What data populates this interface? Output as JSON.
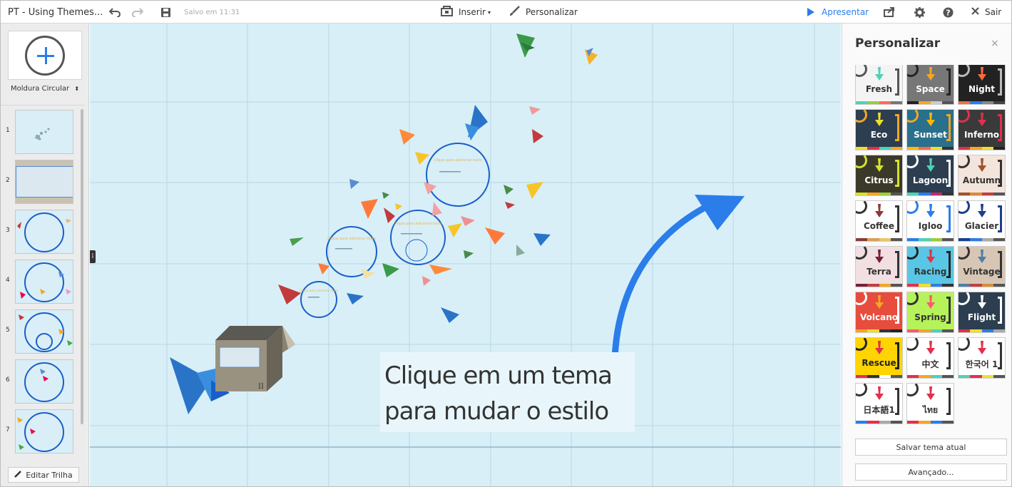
{
  "topbar": {
    "doc_title": "PT - Using Themes...",
    "saved": "Salvo em 11:31",
    "insert": "Inserir",
    "customize": "Personalizar",
    "present": "Apresentar",
    "exit": "Sair"
  },
  "left": {
    "frame_type": "Moldura Circular",
    "thumb_numbers": [
      "1",
      "2",
      "3",
      "4",
      "5",
      "6",
      "7"
    ],
    "edit_trail": "Editar Trilha"
  },
  "canvas": {
    "caption_line1": "Clique em um tema",
    "caption_line2": "para mudar o estilo",
    "frame_text": "Clique para adicionar texto",
    "box_label": "II",
    "side_tab": "⁞"
  },
  "right": {
    "title": "Personalizar",
    "close": "×",
    "save_theme": "Salvar tema atual",
    "advanced": "Avançado...",
    "themes": [
      {
        "name": "Fresh",
        "bg": "#f4f4f4",
        "fg": "#333333",
        "accent": "#4fd1b4",
        "bracket": "#555555",
        "band": [
          "#4fd1b4",
          "#9ccc3a",
          "#ff6a5a",
          "#777"
        ]
      },
      {
        "name": "Space",
        "bg": "#777777",
        "fg": "#ffffff",
        "accent": "#f5a623",
        "bracket": "#222222",
        "band": [
          "#222",
          "#f5a623",
          "#ccc",
          "#555"
        ]
      },
      {
        "name": "Night",
        "bg": "#222222",
        "fg": "#ffffff",
        "accent": "#ff6a3d",
        "bracket": "#bbbbbb",
        "band": [
          "#ff6a3d",
          "#2b7de9",
          "#888",
          "#444"
        ]
      },
      {
        "name": "Eco",
        "bg": "#2c3e50",
        "fg": "#ffffff",
        "accent": "#f1e027",
        "bracket": "#f5a623",
        "band": [
          "#f1e027",
          "#e0314b",
          "#4fd1b4",
          "#f5a623"
        ]
      },
      {
        "name": "Sunset",
        "bg": "#2a6f8c",
        "fg": "#ffffff",
        "accent": "#ffb800",
        "bracket": "#f5a623",
        "band": [
          "#ffb800",
          "#ff6a3d",
          "#f1e027",
          "#333"
        ]
      },
      {
        "name": "Inferno",
        "bg": "#3a3a3a",
        "fg": "#ffffff",
        "accent": "#e0314b",
        "bracket": "#e0314b",
        "band": [
          "#e0314b",
          "#f5a623",
          "#f1e027",
          "#222"
        ]
      },
      {
        "name": "Citrus",
        "bg": "#3b3a2a",
        "fg": "#ffffff",
        "accent": "#d6e32a",
        "bracket": "#d6e32a",
        "band": [
          "#d6e32a",
          "#f5a623",
          "#9ccc3a",
          "#555"
        ]
      },
      {
        "name": "Lagoon",
        "bg": "#2c3e50",
        "fg": "#ffffff",
        "accent": "#4fd1b4",
        "bracket": "#ffffff",
        "band": [
          "#4fd1b4",
          "#2b7de9",
          "#c02a6a",
          "#333"
        ]
      },
      {
        "name": "Autumn",
        "bg": "#f3e4dc",
        "fg": "#333333",
        "accent": "#a0522d",
        "bracket": "#333333",
        "band": [
          "#a0522d",
          "#d98c3a",
          "#c04040",
          "#555"
        ]
      },
      {
        "name": "Coffee",
        "bg": "#ffffff",
        "fg": "#333333",
        "accent": "#8b3a3a",
        "bracket": "#333333",
        "band": [
          "#8b3a3a",
          "#d4a15a",
          "#e9c46a",
          "#555"
        ]
      },
      {
        "name": "Igloo",
        "bg": "#ffffff",
        "fg": "#333333",
        "accent": "#2b7de9",
        "bracket": "#2b7de9",
        "band": [
          "#2b7de9",
          "#4fd1b4",
          "#9ccc3a",
          "#555"
        ]
      },
      {
        "name": "Glacier",
        "bg": "#ffffff",
        "fg": "#333333",
        "accent": "#1a3e8c",
        "bracket": "#1a3e8c",
        "band": [
          "#1a3e8c",
          "#2b7de9",
          "#aaa",
          "#555"
        ]
      },
      {
        "name": "Terra",
        "bg": "#f1dfe1",
        "fg": "#333333",
        "accent": "#7a1e3a",
        "bracket": "#333333",
        "band": [
          "#7a1e3a",
          "#c04040",
          "#f5a623",
          "#555"
        ]
      },
      {
        "name": "Racing",
        "bg": "#59c6e6",
        "fg": "#333333",
        "accent": "#e0314b",
        "bracket": "#222222",
        "band": [
          "#e0314b",
          "#f1e027",
          "#2b7de9",
          "#333"
        ]
      },
      {
        "name": "Vintage",
        "bg": "#d8c6b5",
        "fg": "#333333",
        "accent": "#4d7ea8",
        "bracket": "#333333",
        "band": [
          "#4d7ea8",
          "#c04040",
          "#d98c3a",
          "#555"
        ]
      },
      {
        "name": "Volcano",
        "bg": "#e74c3c",
        "fg": "#ffffff",
        "accent": "#f5a623",
        "bracket": "#ffffff",
        "band": [
          "#f5a623",
          "#f1e027",
          "#333",
          "#222"
        ]
      },
      {
        "name": "Spring",
        "bg": "#b6f25a",
        "fg": "#333333",
        "accent": "#ff5a6a",
        "bracket": "#333333",
        "band": [
          "#ff5a6a",
          "#f5a623",
          "#4fd1b4",
          "#555"
        ]
      },
      {
        "name": "Flight",
        "bg": "#2c3e50",
        "fg": "#ffffff",
        "accent": "#ffffff",
        "bracket": "#ffffff",
        "band": [
          "#e0314b",
          "#f1e027",
          "#2b7de9",
          "#aaa"
        ]
      },
      {
        "name": "Rescue",
        "bg": "#ffd400",
        "fg": "#222222",
        "accent": "#e0314b",
        "bracket": "#222222",
        "band": [
          "#e0314b",
          "#333",
          "#ffffff",
          "#555"
        ]
      },
      {
        "name": "中文",
        "bg": "#ffffff",
        "fg": "#333333",
        "accent": "#e0314b",
        "bracket": "#333333",
        "band": [
          "#e0314b",
          "#f5a623",
          "#4fd1b4",
          "#555"
        ]
      },
      {
        "name": "한국어 1",
        "bg": "#ffffff",
        "fg": "#333333",
        "accent": "#e0314b",
        "bracket": "#333333",
        "band": [
          "#4fd1b4",
          "#e0314b",
          "#f1e027",
          "#555"
        ]
      },
      {
        "name": "日本語1",
        "bg": "#ffffff",
        "fg": "#333333",
        "accent": "#e0314b",
        "bracket": "#333333",
        "band": [
          "#2b7de9",
          "#e0314b",
          "#aaa",
          "#555"
        ]
      },
      {
        "name": "ไทย",
        "bg": "#ffffff",
        "fg": "#333333",
        "accent": "#e0314b",
        "bracket": "#333333",
        "band": [
          "#e0314b",
          "#f5a623",
          "#2b7de9",
          "#555"
        ]
      }
    ]
  },
  "colors": {
    "accent": "#2b7de9",
    "canvas_bg": "#d8eff8",
    "frame_ring": "#1a5fc8"
  }
}
